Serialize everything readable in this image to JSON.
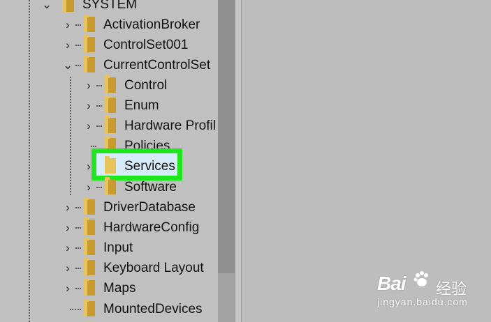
{
  "tree": {
    "root_label": "SYSTEM",
    "children": [
      {
        "label": "ActivationBroker",
        "expanded": false
      },
      {
        "label": "ControlSet001",
        "expanded": false
      },
      {
        "label": "CurrentControlSet",
        "expanded": true
      },
      {
        "label": "DriverDatabase",
        "expanded": false
      },
      {
        "label": "HardwareConfig",
        "expanded": false
      },
      {
        "label": "Input",
        "expanded": false
      },
      {
        "label": "Keyboard Layout",
        "expanded": false
      },
      {
        "label": "Maps",
        "expanded": false
      },
      {
        "label": "MountedDevices",
        "expanded": false
      }
    ],
    "current_control_set_children": [
      {
        "label": "Control"
      },
      {
        "label": "Enum"
      },
      {
        "label": "Hardware Profil"
      },
      {
        "label": "Policies"
      },
      {
        "label": "Services",
        "selected": true
      },
      {
        "label": "Software"
      }
    ]
  },
  "colors": {
    "highlight": "#1ee51e",
    "selection": "#d6ecfa",
    "folder": "#c99a2e"
  },
  "watermark": {
    "brand": "Bai",
    "text": "经验",
    "url": "jingyan.baidu.com"
  }
}
